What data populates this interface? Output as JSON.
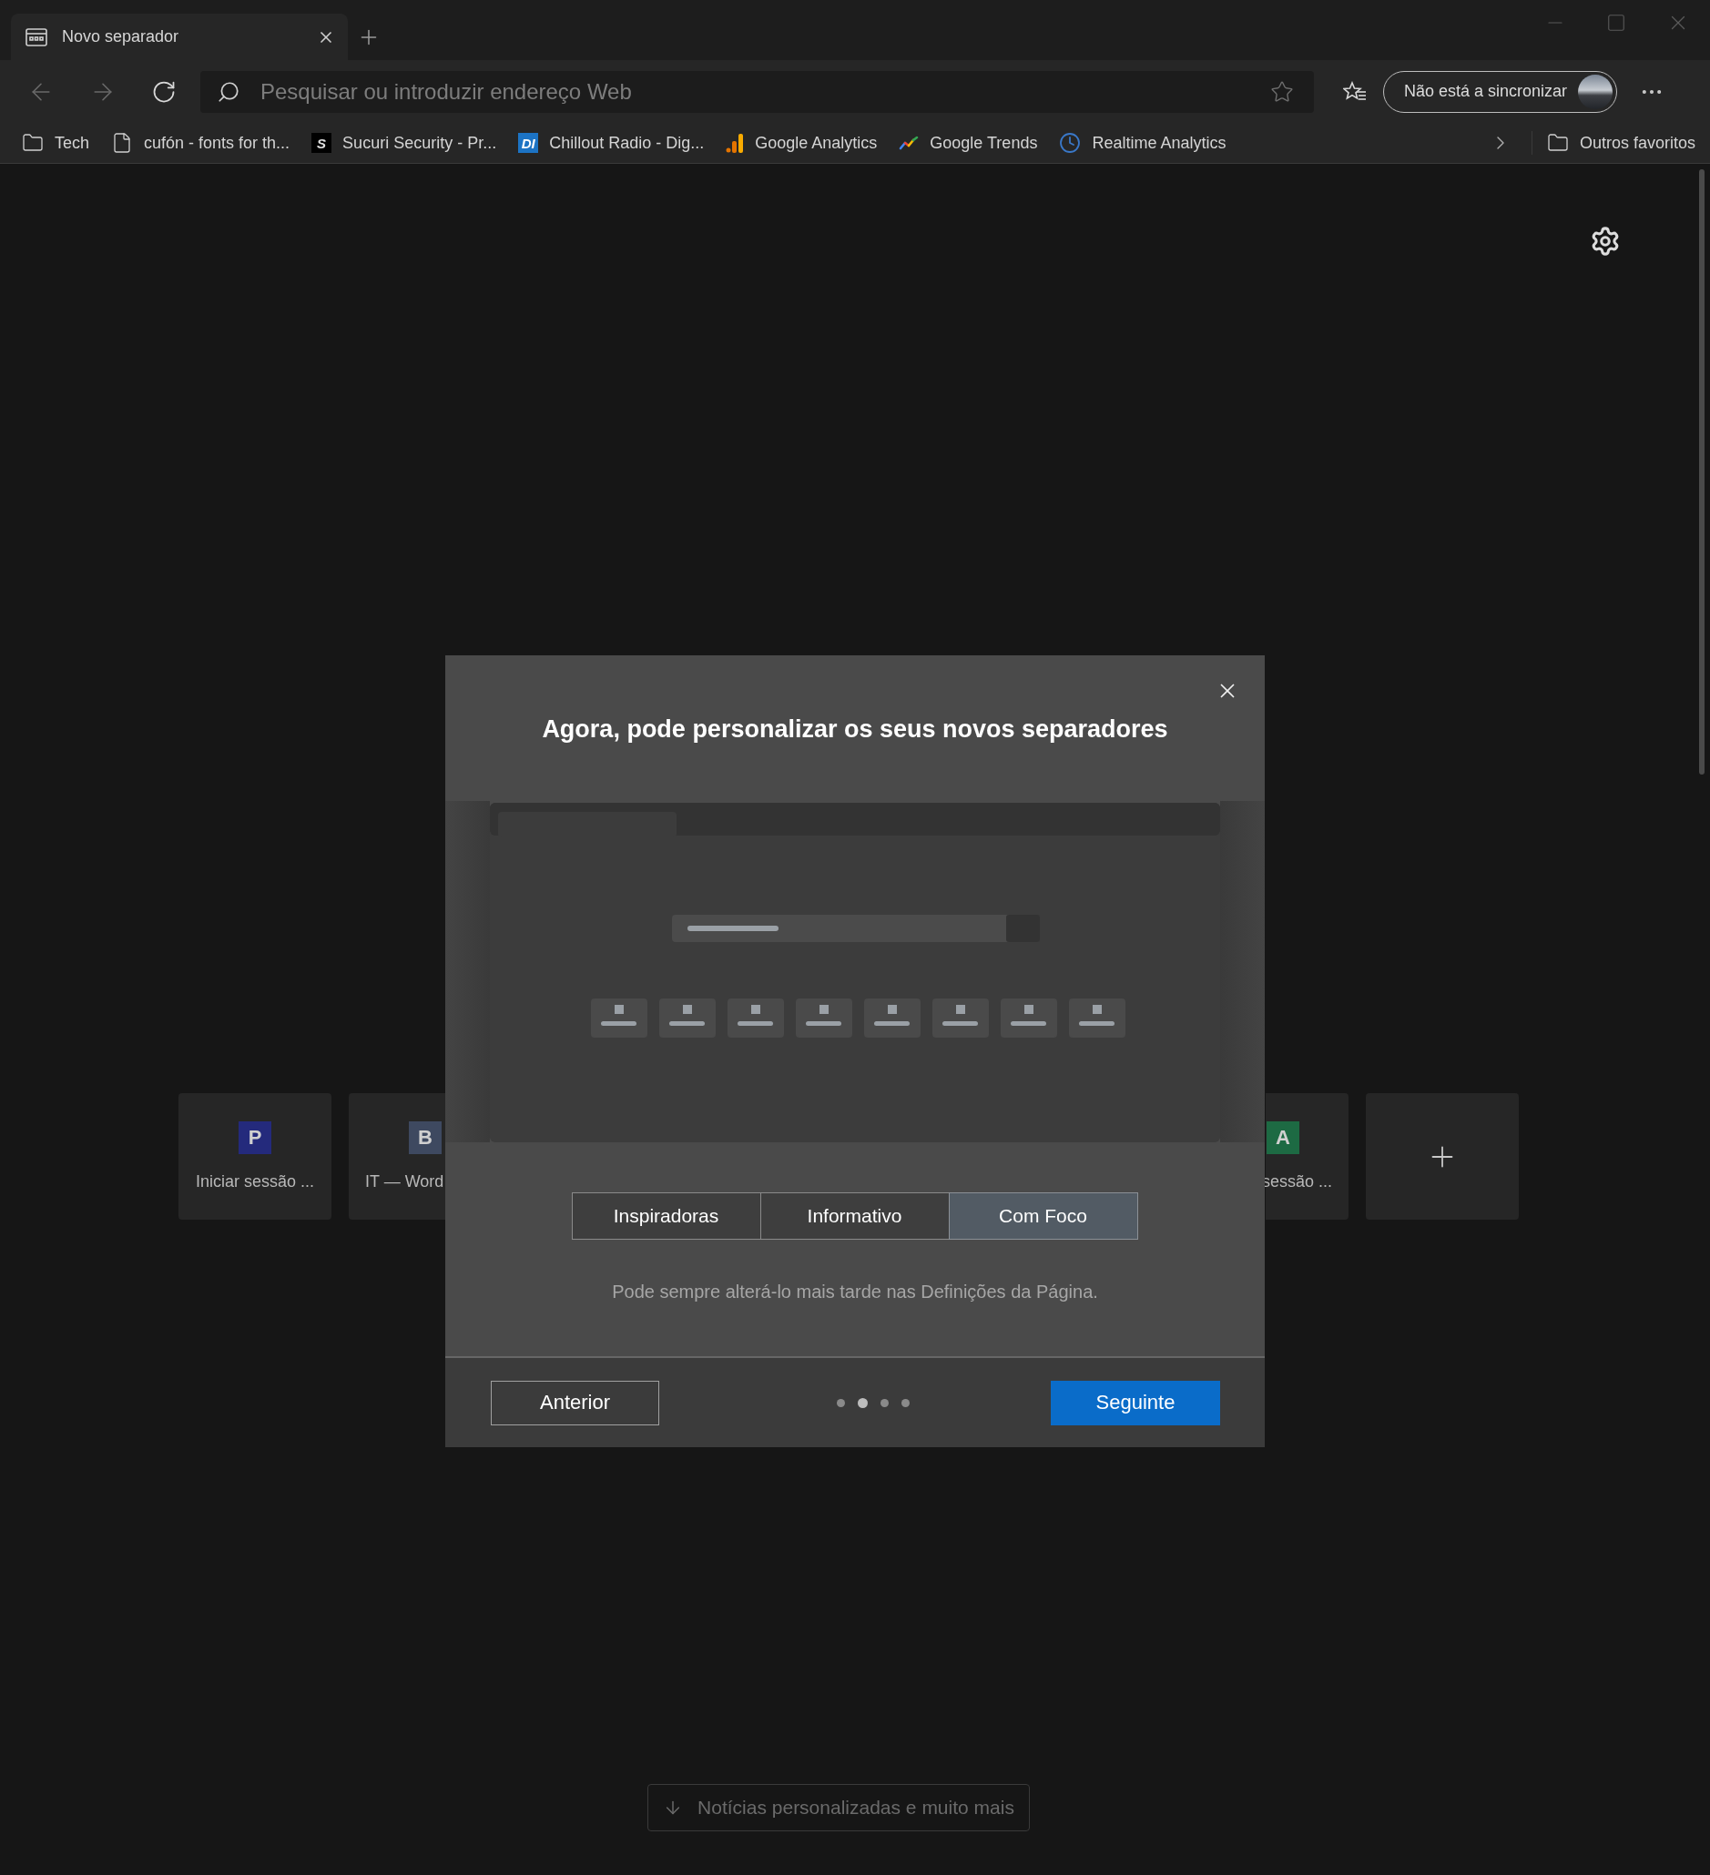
{
  "window": {
    "tab_title": "Novo separador"
  },
  "toolbar": {
    "address_placeholder": "Pesquisar ou introduzir endereço Web",
    "sync_button": "Não está a sincronizar"
  },
  "bookmarks": [
    {
      "kind": "folder",
      "label": "Tech"
    },
    {
      "kind": "page",
      "label": "cufón - fonts for th..."
    },
    {
      "kind": "sucuri",
      "badge": "S",
      "label": "Sucuri Security - Pr..."
    },
    {
      "kind": "di",
      "badge": "DI",
      "label": "Chillout Radio - Dig..."
    },
    {
      "kind": "analytics",
      "label": "Google Analytics"
    },
    {
      "kind": "trends",
      "label": "Google Trends"
    },
    {
      "kind": "clock",
      "label": "Realtime Analytics"
    }
  ],
  "other_favorites": "Outros favoritos",
  "tiles": [
    {
      "kind": "site",
      "letter": "P",
      "label": "Iniciar sessão ...",
      "color": "#242a7c"
    },
    {
      "kind": "cut_right",
      "letter": "B",
      "label": "IT — Word",
      "color": "#3e4960"
    },
    {
      "kind": "cut_left",
      "letter": "A",
      "label": "sessão ...",
      "color": "#1d6a43"
    },
    {
      "kind": "add"
    }
  ],
  "dialog": {
    "title": "Agora, pode personalizar os seus novos separadores",
    "options": [
      {
        "label": "Inspiradoras",
        "selected": false
      },
      {
        "label": "Informativo",
        "selected": false
      },
      {
        "label": "Com Foco",
        "selected": true
      }
    ],
    "hint": "Pode sempre alterá-lo mais tarde nas Definições da Página.",
    "previous": "Anterior",
    "next": "Seguinte",
    "steps": [
      {
        "selected": false
      },
      {
        "selected": true
      },
      {
        "selected": false
      },
      {
        "selected": false
      }
    ]
  },
  "news_button": "Notícias personalizadas e muito mais"
}
